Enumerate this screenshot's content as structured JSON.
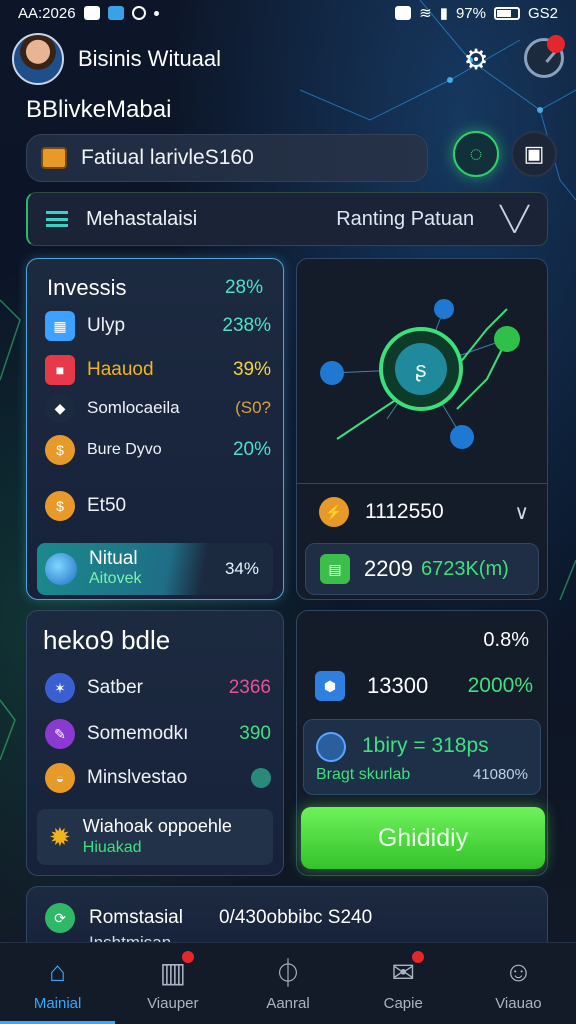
{
  "status_bar": {
    "time": "AA:2026",
    "battery": "97%",
    "carrier": "GS2"
  },
  "header": {
    "title": "Bisinis Wituaal"
  },
  "subtitle": "BBlivkeMabai",
  "account_pill": {
    "text": "Fatiual larivleS160"
  },
  "menu_bar": {
    "label": "Mehastalaisi",
    "right_label": "Ranting Patuan"
  },
  "invest_card": {
    "title": "Invessis",
    "title_pct": "28%",
    "rows": [
      {
        "label": "Ulyp",
        "value": "238%",
        "icon": "grid-icon",
        "color": "#3ea0ff"
      },
      {
        "label": "Haauod",
        "value": "39%",
        "icon": "square-icon",
        "color": "#e63a4a"
      },
      {
        "label": "Somlocaeila",
        "value": "(S0?",
        "icon": "diamond-icon",
        "color": "#d7a33a"
      },
      {
        "label": "Bure Dyvo",
        "value": "20%",
        "icon": "coin-icon",
        "color": "#e79a2a"
      },
      {
        "label": "Et50",
        "value": "",
        "icon": "coin-icon",
        "color": "#e79a2a"
      }
    ],
    "highlight": {
      "title": "Nitual",
      "subtitle": "Aitovek",
      "value": "34%"
    }
  },
  "graph_card": {
    "value_label": "1112550",
    "pill_big": "2209",
    "pill_small": "6723K(m)"
  },
  "notes_card": {
    "title": "heko9 bdle",
    "rows": [
      {
        "label": "Satber",
        "value": "2366",
        "color": "#e8509a"
      },
      {
        "label": "Somemodkı",
        "value": "390",
        "color": "#3ee07f"
      },
      {
        "label": "Minslvestao",
        "value": "",
        "color": "#3ee07f"
      }
    ],
    "box": {
      "title": "Wiahoak oppoehle",
      "subtitle": "Hiuakad"
    }
  },
  "stats_card": {
    "pct": "0.8%",
    "big": "13300",
    "green": "2000%",
    "box_title": "1biry = 318ps",
    "box_left": "Bragt skurlab",
    "box_right": "41080%",
    "button": "Ghididiy"
  },
  "bottom_card": {
    "label": "Romstasial",
    "value": "0/430obbibc S240",
    "line2": "Inshtmisan"
  },
  "tabs": [
    {
      "label": "Mainial",
      "icon": "home-icon",
      "active": true
    },
    {
      "label": "Viauper",
      "icon": "stats-icon",
      "active": false
    },
    {
      "label": "Aanral",
      "icon": "power-icon",
      "active": false
    },
    {
      "label": "Capie",
      "icon": "mail-icon",
      "active": false
    },
    {
      "label": "Viauao",
      "icon": "user-icon",
      "active": false
    }
  ]
}
